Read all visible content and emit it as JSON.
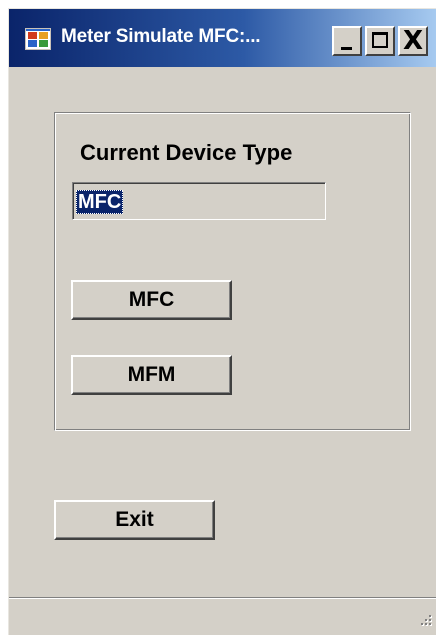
{
  "window": {
    "title": "Meter Simulate MFC:...",
    "controls": {
      "minimize": "_",
      "maximize": "□",
      "close": "X"
    }
  },
  "group": {
    "label": "Current Device Type",
    "device_type_value": "MFC",
    "buttons": {
      "mfc": "MFC",
      "mfm": "MFM"
    }
  },
  "footer": {
    "exit_label": "Exit"
  },
  "icons": {
    "app": "app-window-icon",
    "grip": "resize-grip-icon"
  },
  "colors": {
    "titlebar_start": "#0a246a",
    "titlebar_end": "#a6caf0",
    "window_bg": "#d4d0c8",
    "selection_bg": "#0a246a"
  }
}
